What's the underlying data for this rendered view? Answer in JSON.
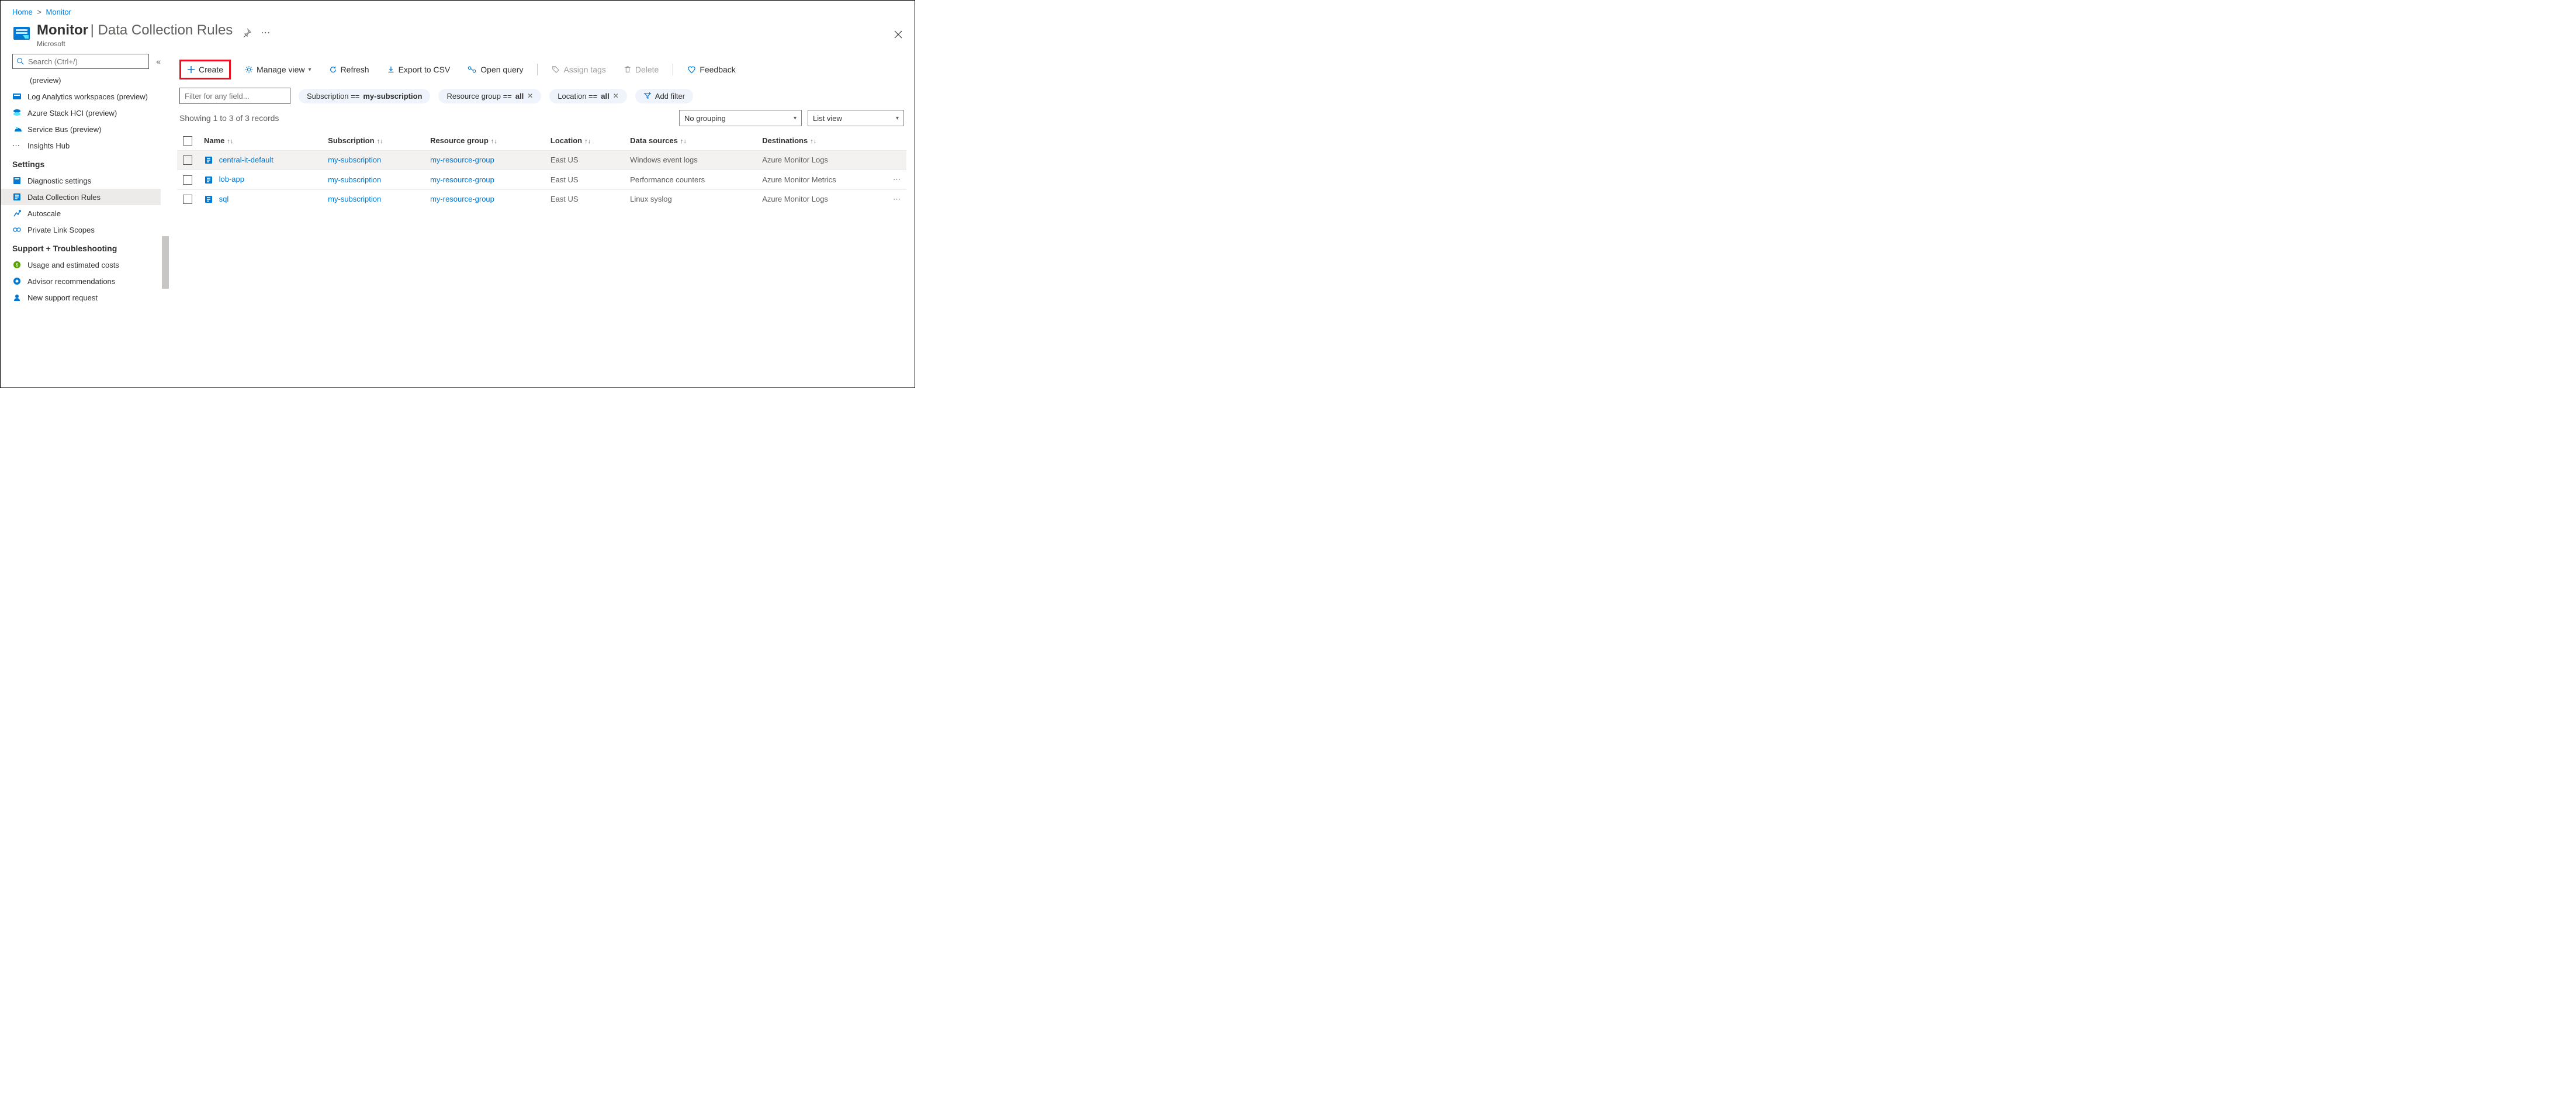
{
  "breadcrumb": {
    "home": "Home",
    "monitor": "Monitor"
  },
  "header": {
    "title": "Monitor",
    "subtitle": "Data Collection Rules",
    "vendor": "Microsoft"
  },
  "search": {
    "placeholder": "Search (Ctrl+/)"
  },
  "sidebar": {
    "items_top": [
      {
        "label": "(preview)"
      },
      {
        "label": "Log Analytics workspaces (preview)"
      },
      {
        "label": "Azure Stack HCI (preview)"
      },
      {
        "label": "Service Bus (preview)"
      },
      {
        "label": "Insights Hub"
      }
    ],
    "settings_heading": "Settings",
    "settings_items": [
      {
        "label": "Diagnostic settings"
      },
      {
        "label": "Data Collection Rules"
      },
      {
        "label": "Autoscale"
      },
      {
        "label": "Private Link Scopes"
      }
    ],
    "support_heading": "Support + Troubleshooting",
    "support_items": [
      {
        "label": "Usage and estimated costs"
      },
      {
        "label": "Advisor recommendations"
      },
      {
        "label": "New support request"
      }
    ]
  },
  "toolbar": {
    "create": "Create",
    "manage_view": "Manage view",
    "refresh": "Refresh",
    "export_csv": "Export to CSV",
    "open_query": "Open query",
    "assign_tags": "Assign tags",
    "delete": "Delete",
    "feedback": "Feedback"
  },
  "filters": {
    "field_placeholder": "Filter for any field...",
    "subscription_prefix": "Subscription ==",
    "subscription_value": "my-subscription",
    "resource_group_prefix": "Resource group ==",
    "resource_group_value": "all",
    "location_prefix": "Location ==",
    "location_value": "all",
    "add_filter": "Add filter"
  },
  "records_text": "Showing 1 to 3 of 3 records",
  "grouping": {
    "selected": "No grouping"
  },
  "view": {
    "selected": "List view"
  },
  "columns": {
    "name": "Name",
    "subscription": "Subscription",
    "resource_group": "Resource group",
    "location": "Location",
    "data_sources": "Data sources",
    "destinations": "Destinations"
  },
  "rows": [
    {
      "name": "central-it-default",
      "subscription": "my-subscription",
      "resource_group": "my-resource-group",
      "location": "East US",
      "data_sources": "Windows event logs",
      "destinations": "Azure Monitor Logs"
    },
    {
      "name": "lob-app",
      "subscription": "my-subscription",
      "resource_group": "my-resource-group",
      "location": "East US",
      "data_sources": "Performance counters",
      "destinations": "Azure Monitor Metrics"
    },
    {
      "name": "sql",
      "subscription": "my-subscription",
      "resource_group": "my-resource-group",
      "location": "East US",
      "data_sources": "Linux syslog",
      "destinations": "Azure Monitor Logs"
    }
  ]
}
